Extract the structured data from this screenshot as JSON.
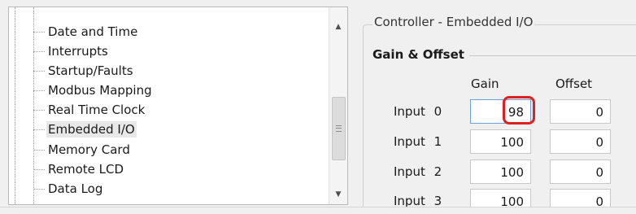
{
  "tree": {
    "items": [
      {
        "label": "Date and Time"
      },
      {
        "label": "Interrupts"
      },
      {
        "label": "Startup/Faults"
      },
      {
        "label": "Modbus Mapping"
      },
      {
        "label": "Real Time Clock"
      },
      {
        "label": "Embedded I/O",
        "selected": true
      },
      {
        "label": "Memory Card"
      },
      {
        "label": "Remote LCD"
      },
      {
        "label": "Data Log"
      }
    ],
    "scroll_up_glyph": "▲",
    "scroll_down_glyph": "▼"
  },
  "controller": {
    "title": "Controller - Embedded I/O",
    "group_title": "Gain & Offset",
    "col_gain": "Gain",
    "col_offset": "Offset",
    "rows": [
      {
        "label": "Input 0",
        "gain": "98",
        "offset": "0"
      },
      {
        "label": "Input 1",
        "gain": "100",
        "offset": "0"
      },
      {
        "label": "Input 2",
        "gain": "100",
        "offset": "0"
      },
      {
        "label": "Input 3",
        "gain": "100",
        "offset": "0"
      }
    ],
    "highlight_color": "#e02020"
  }
}
